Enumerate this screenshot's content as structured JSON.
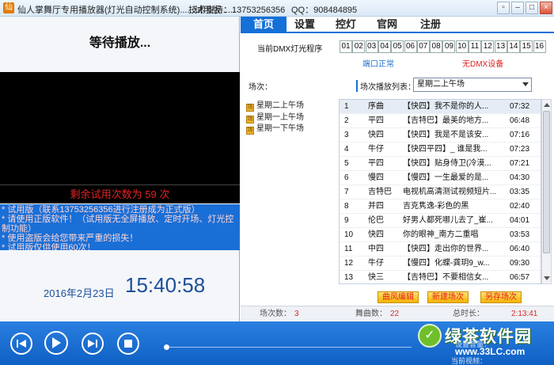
{
  "window": {
    "title": "仙人掌舞厅专用播放器(灯光自动控制系统)......试用版......",
    "support": "技术支持：13753256356",
    "qq": "QQ：908484895",
    "controls": [
      "▫",
      "–",
      "□",
      "×"
    ]
  },
  "left": {
    "status": "等待播放...",
    "trial_remaining": "剩余试用次数为 59 次",
    "notice_lines": [
      "* 试用版（联系13753256356进行注册成为正式版）",
      "* 请使用正版软件！（试用版无全屏播放、定时开场、灯光控",
      "制功能）",
      "* 使用盗版会给您带来严重的损失！",
      "* 试用版仅供使用60次！"
    ],
    "date": "2016年2月23日",
    "clock": "15:40:58"
  },
  "tabs": [
    "首页",
    "设置",
    "控灯",
    "官网",
    "注册"
  ],
  "dmx": {
    "label": "当前DMX灯光程序",
    "channels": [
      "01",
      "02",
      "03",
      "04",
      "05",
      "06",
      "07",
      "08",
      "09",
      "10",
      "11",
      "12",
      "13",
      "14",
      "15",
      "16"
    ],
    "port_status": "端口正常",
    "device_status": "无DMX设备"
  },
  "scenes": {
    "label": "场次：",
    "items": [
      "星期二上午场",
      "星期一上午场",
      "星期一下午场"
    ]
  },
  "playlist": {
    "label": "场次播放列表：",
    "selected": "星期二上午场",
    "rows": [
      {
        "num": "1",
        "dance": "序曲",
        "title": "【快四】我不是你的人...",
        "duration": "07:32"
      },
      {
        "num": "2",
        "dance": "平四",
        "title": "【吉特巴】最美的地方...",
        "duration": "06:48"
      },
      {
        "num": "3",
        "dance": "快四",
        "title": "【快四】我是不是该安...",
        "duration": "07:16"
      },
      {
        "num": "4",
        "dance": "牛仔",
        "title": "【快四平四】_ 谁是我...",
        "duration": "07:23"
      },
      {
        "num": "5",
        "dance": "平四",
        "title": "【快四】贴身侍卫(冷漠...",
        "duration": "07:21"
      },
      {
        "num": "6",
        "dance": "慢四",
        "title": "【慢四】一生最爱的是...",
        "duration": "04:30"
      },
      {
        "num": "7",
        "dance": "吉特巴",
        "title": "电视机高清测试视频短片...",
        "duration": "03:35"
      },
      {
        "num": "8",
        "dance": "并四",
        "title": "吉克隽逸-彩色的黑",
        "duration": "02:40"
      },
      {
        "num": "9",
        "dance": "伦巴",
        "title": "好男人都死哪儿去了_崔...",
        "duration": "04:01"
      },
      {
        "num": "10",
        "dance": "快四",
        "title": "你的眼神_南方二重唱",
        "duration": "03:53"
      },
      {
        "num": "11",
        "dance": "中四",
        "title": "【快四】走出你的世界...",
        "duration": "06:40"
      },
      {
        "num": "12",
        "dance": "牛仔",
        "title": "【慢四】化蝶-龚玥9_w...",
        "duration": "09:30"
      },
      {
        "num": "13",
        "dance": "快三",
        "title": "【吉特巴】不要相信女...",
        "duration": "06:57"
      }
    ]
  },
  "actions": {
    "edit": "曲风编辑",
    "new_scene": "新建场次",
    "save_scene": "另存场次"
  },
  "stats": {
    "scenes_label": "场次数：",
    "scenes_value": "3",
    "songs_label": "舞曲数：",
    "songs_value": "22",
    "time_label": "总时长：",
    "time_value": "2:13:41"
  },
  "player": {
    "volume_label": "设置音量：",
    "watermark_brand": "绿茶软件园",
    "watermark_url": "www.33LC.com",
    "watermark_sub": "当前视频："
  },
  "colors": {
    "accent": "#1570d8",
    "alert": "#e02424",
    "clock": "#1b4f9a"
  }
}
